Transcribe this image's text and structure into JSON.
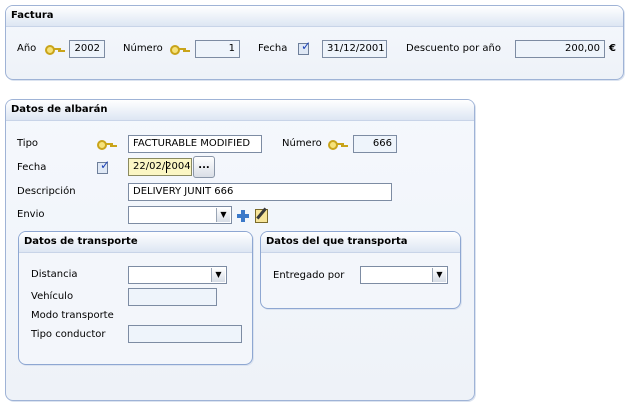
{
  "factura": {
    "title": "Factura",
    "ano_label": "Año",
    "ano_value": "2002",
    "numero_label": "Número",
    "numero_value": "1",
    "fecha_label": "Fecha",
    "fecha_value": "31/12/2001",
    "descuento_label": "Descuento por año",
    "descuento_value": "200,00",
    "currency": "€"
  },
  "albaran": {
    "title": "Datos de albarán",
    "tipo_label": "Tipo",
    "tipo_value": "FACTURABLE MODIFIED",
    "numero_label": "Número",
    "numero_value": "666",
    "fecha_label": "Fecha",
    "fecha_value": "22/02/2004",
    "fecha_button": "...",
    "descripcion_label": "Descripción",
    "descripcion_value": "DELIVERY JUNIT 666",
    "envio_label": "Envio",
    "envio_value": ""
  },
  "transporte": {
    "title": "Datos de transporte",
    "distancia_label": "Distancia",
    "distancia_value": "",
    "vehiculo_label": "Vehículo",
    "vehiculo_value": "",
    "modo_label": "Modo transporte",
    "tipo_conductor_label": "Tipo conductor",
    "tipo_conductor_value": ""
  },
  "transportista": {
    "title": "Datos del que transporta",
    "entregado_label": "Entregado por",
    "entregado_value": ""
  },
  "icons": {
    "key": "key-icon",
    "calendar": "calendar-check-icon",
    "dropdown": "chevron-down-icon",
    "add": "plus-icon",
    "edit": "edit-icon"
  },
  "colors": {
    "frame_border": "#9fb3d6",
    "field_bg": "#eef4fb",
    "focus_bg": "#fbf6c4",
    "plus_blue": "#3b79c9"
  }
}
